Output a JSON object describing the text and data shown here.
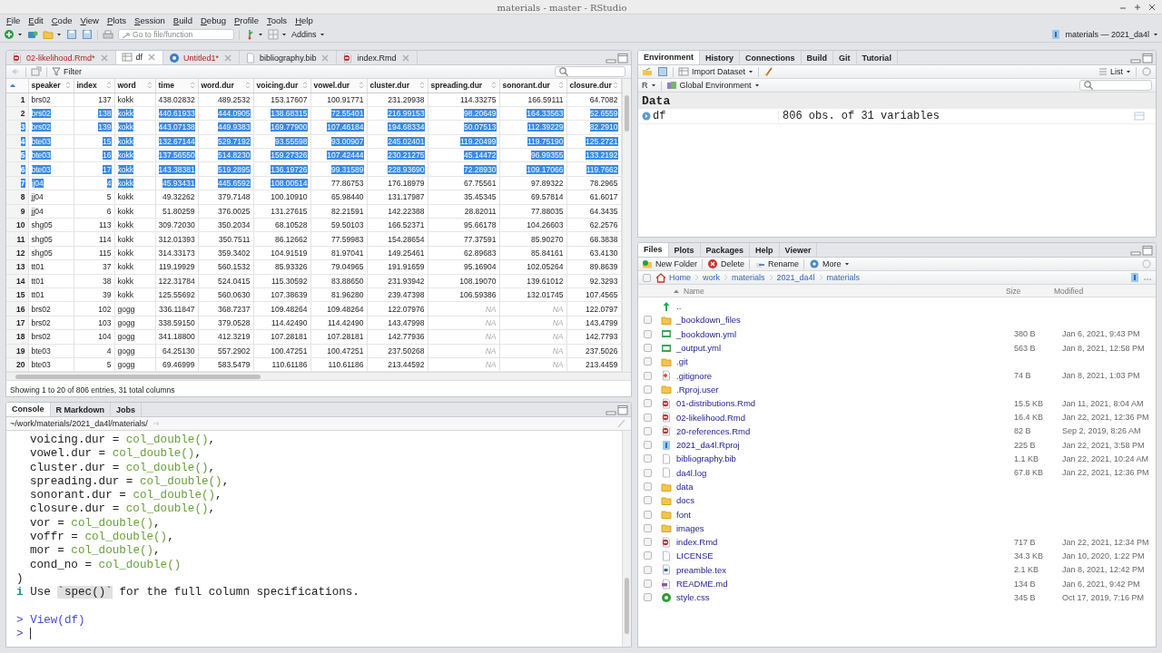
{
  "window": {
    "title": "materials - master - RStudio"
  },
  "menu": [
    "File",
    "Edit",
    "Code",
    "View",
    "Plots",
    "Session",
    "Build",
    "Debug",
    "Profile",
    "Tools",
    "Help"
  ],
  "toolbar": {
    "search_placeholder": "Go to file/function",
    "addins": "Addins",
    "project": "materials — 2021_da4l"
  },
  "source": {
    "tabs": [
      {
        "label": "02-likelihood.Rmd*",
        "kind": "rmd",
        "selected": false,
        "modified": true
      },
      {
        "label": "df",
        "kind": "table",
        "selected": true,
        "modified": false
      },
      {
        "label": "Untitled1*",
        "kind": "script",
        "selected": false,
        "modified": true
      },
      {
        "label": "bibliography.bib",
        "kind": "file",
        "selected": false,
        "modified": false
      },
      {
        "label": "index.Rmd",
        "kind": "rmd",
        "selected": false,
        "modified": false
      }
    ],
    "filter": "Filter",
    "table": {
      "columns": [
        {
          "label": "speaker",
          "kind": "text"
        },
        {
          "label": "index",
          "kind": "number"
        },
        {
          "label": "word",
          "kind": "text"
        },
        {
          "label": "time",
          "kind": "number"
        },
        {
          "label": "word.dur",
          "kind": "number"
        },
        {
          "label": "voicing.dur",
          "kind": "number"
        },
        {
          "label": "vowel.dur",
          "kind": "number"
        },
        {
          "label": "cluster.dur",
          "kind": "number"
        },
        {
          "label": "spreading.dur",
          "kind": "number"
        },
        {
          "label": "sonorant.dur",
          "kind": "number"
        },
        {
          "label": "closure.dur",
          "kind": "number"
        }
      ],
      "rows": [
        {
          "number": "1",
          "cells": [
            "brs02",
            "137",
            "kokk",
            "438.02832",
            "489.2532",
            "153.17607",
            "100.91771",
            "231.29938",
            "114.33275",
            "166.59111",
            "64.7082"
          ]
        },
        {
          "number": "2",
          "cells": [
            "brs02",
            "138",
            "kokk",
            "440.61933",
            "444.0905",
            "138.68315",
            "72.55401",
            "216.99153",
            "98.20649",
            "164.33563",
            "52.6559"
          ],
          "selected": [
            false,
            true,
            true,
            true,
            true,
            true,
            true,
            true,
            true,
            true,
            true,
            true
          ]
        },
        {
          "number": "3",
          "cells": [
            "brs02",
            "139",
            "kokk",
            "443.07138",
            "449.9383",
            "169.77900",
            "107.46184",
            "194.68334",
            "50.07513",
            "112.39229",
            "82.2910"
          ],
          "selected": [
            true,
            true,
            true,
            true,
            true,
            true,
            true,
            true,
            true,
            true,
            true,
            true
          ]
        },
        {
          "number": "4",
          "cells": [
            "bte03",
            "15",
            "kokk",
            "132.67144",
            "529.7192",
            "93.55598",
            "93.00907",
            "245.02401",
            "119.20499",
            "119.75190",
            "125.2721"
          ],
          "selected": [
            true,
            true,
            true,
            true,
            true,
            true,
            true,
            true,
            true,
            true,
            true,
            true
          ]
        },
        {
          "number": "5",
          "cells": [
            "bte03",
            "16",
            "kokk",
            "137.56550",
            "514.8230",
            "159.27326",
            "107.42444",
            "230.21275",
            "45.14472",
            "96.99355",
            "133.2192"
          ],
          "selected": [
            true,
            true,
            true,
            true,
            true,
            true,
            true,
            true,
            true,
            true,
            true,
            true
          ]
        },
        {
          "number": "6",
          "cells": [
            "bte03",
            "17",
            "kokk",
            "143.38381",
            "519.2895",
            "136.19726",
            "99.31589",
            "228.93690",
            "72.28930",
            "109.17066",
            "119.7662"
          ],
          "selected": [
            true,
            true,
            true,
            true,
            true,
            true,
            true,
            true,
            true,
            true,
            true,
            true
          ]
        },
        {
          "number": "7",
          "cells": [
            "jj04",
            "4",
            "kokk",
            "45.93431",
            "445.6592",
            "108.00514",
            "77.86753",
            "176.18979",
            "67.75561",
            "97.89322",
            "78.2965"
          ],
          "selected": [
            true,
            true,
            true,
            true,
            true,
            true,
            true,
            false,
            false,
            false,
            false,
            false
          ]
        },
        {
          "number": "8",
          "cells": [
            "jj04",
            "5",
            "kokk",
            "49.32262",
            "379.7148",
            "100.10910",
            "65.98440",
            "131.17987",
            "35.45345",
            "69.57814",
            "61.6017"
          ]
        },
        {
          "number": "9",
          "cells": [
            "jj04",
            "6",
            "kokk",
            "51.80259",
            "376.0025",
            "131.27615",
            "82.21591",
            "142.22388",
            "28.82011",
            "77.88035",
            "64.3435"
          ]
        },
        {
          "number": "10",
          "cells": [
            "shg05",
            "113",
            "kokk",
            "309.72030",
            "350.2034",
            "68.10528",
            "59.50103",
            "166.52371",
            "95.66178",
            "104.26603",
            "62.2576"
          ]
        },
        {
          "number": "11",
          "cells": [
            "shg05",
            "114",
            "kokk",
            "312.01393",
            "350.7511",
            "86.12662",
            "77.59983",
            "154.28654",
            "77.37591",
            "85.90270",
            "68.3838"
          ]
        },
        {
          "number": "12",
          "cells": [
            "shg05",
            "115",
            "kokk",
            "314.33173",
            "359.3402",
            "104.91519",
            "81.97041",
            "149.25461",
            "62.89683",
            "85.84161",
            "63.4130"
          ]
        },
        {
          "number": "13",
          "cells": [
            "tt01",
            "37",
            "kokk",
            "119.19929",
            "560.1532",
            "85.93326",
            "79.04965",
            "191.91659",
            "95.16904",
            "102.05264",
            "89.8639"
          ]
        },
        {
          "number": "14",
          "cells": [
            "tt01",
            "38",
            "kokk",
            "122.31784",
            "524.0415",
            "115.30592",
            "83.88650",
            "231.93942",
            "108.19070",
            "139.61012",
            "92.3293"
          ]
        },
        {
          "number": "15",
          "cells": [
            "tt01",
            "39",
            "kokk",
            "125.55692",
            "560.0630",
            "107.38639",
            "81.96280",
            "239.47398",
            "106.59386",
            "132.01745",
            "107.4565"
          ]
        },
        {
          "number": "16",
          "cells": [
            "brs02",
            "102",
            "gogg",
            "336.11847",
            "368.7237",
            "109.48264",
            "109.48264",
            "122.07976",
            {
              "text": "NA",
              "kind": "na"
            },
            {
              "text": "NA",
              "kind": "na"
            },
            "122.0797"
          ]
        },
        {
          "number": "17",
          "cells": [
            "brs02",
            "103",
            "gogg",
            "338.59150",
            "379.0528",
            "114.42490",
            "114.42490",
            "143.47998",
            {
              "text": "NA",
              "kind": "na"
            },
            {
              "text": "NA",
              "kind": "na"
            },
            "143.4799"
          ]
        },
        {
          "number": "18",
          "cells": [
            "brs02",
            "104",
            "gogg",
            "341.18800",
            "412.3219",
            "107.28181",
            "107.28181",
            "142.77936",
            {
              "text": "NA",
              "kind": "na"
            },
            {
              "text": "NA",
              "kind": "na"
            },
            "142.7793"
          ]
        },
        {
          "number": "19",
          "cells": [
            "bte03",
            "4",
            "gogg",
            "64.25130",
            "557.2902",
            "100.47251",
            "100.47251",
            "237.50268",
            {
              "text": "NA",
              "kind": "na"
            },
            {
              "text": "NA",
              "kind": "na"
            },
            "237.5026"
          ]
        },
        {
          "number": "20",
          "cells": [
            "bte03",
            "5",
            "gogg",
            "69.46999",
            "583.5479",
            "110.61186",
            "110.61186",
            "213.44592",
            {
              "text": "NA",
              "kind": "na"
            },
            {
              "text": "NA",
              "kind": "na"
            },
            "213.4459"
          ]
        }
      ]
    },
    "footer": "Showing 1 to 20 of 806 entries, 31 total columns"
  },
  "console": {
    "tabs": [
      {
        "label": "Console",
        "selected": true
      },
      {
        "label": "R Markdown",
        "selected": false
      },
      {
        "label": "Jobs",
        "selected": false
      }
    ],
    "path": "~/work/materials/2021_da4l/materials/",
    "lines": [
      {
        "kind": "arg",
        "text": "voicing.dur = ",
        "call": "col_double()",
        "end": ","
      },
      {
        "kind": "arg",
        "text": "vowel.dur = ",
        "call": "col_double()",
        "end": ","
      },
      {
        "kind": "arg",
        "text": "cluster.dur = ",
        "call": "col_double()",
        "end": ","
      },
      {
        "kind": "arg",
        "text": "spreading.dur = ",
        "call": "col_double()",
        "end": ","
      },
      {
        "kind": "arg",
        "text": "sonorant.dur = ",
        "call": "col_double()",
        "end": ","
      },
      {
        "kind": "arg",
        "text": "closure.dur = ",
        "call": "col_double()",
        "end": ","
      },
      {
        "kind": "arg",
        "text": "vor = ",
        "call": "col_double()",
        "end": ","
      },
      {
        "kind": "arg",
        "text": "voffr = ",
        "call": "col_double()",
        "end": ","
      },
      {
        "kind": "arg",
        "text": "mor = ",
        "call": "col_double()",
        "end": ","
      },
      {
        "kind": "arg",
        "text": "cond_no = ",
        "call": "col_double()"
      },
      {
        "kind": "plain",
        "text": ")"
      },
      {
        "kind": "info",
        "mark": "i",
        "text": "Use ",
        "code": "`spec()`",
        "rest": " for the full column specifications."
      },
      {
        "kind": "blank"
      },
      {
        "kind": "input",
        "prompt": ">",
        "text": "View(df)"
      },
      {
        "kind": "input",
        "prompt": ">",
        "cursor": true
      }
    ]
  },
  "environment": {
    "tabs": [
      {
        "label": "Environment",
        "selected": true
      },
      {
        "label": "History",
        "selected": false
      },
      {
        "label": "Connections",
        "selected": false
      },
      {
        "label": "Build",
        "selected": false
      },
      {
        "label": "Git",
        "selected": false
      },
      {
        "label": "Tutorial",
        "selected": false
      }
    ],
    "import": "Import Dataset",
    "view": "List",
    "language": "R",
    "scope": "Global Environment",
    "section": "Data",
    "items": [
      {
        "name": "df",
        "value": "806 obs. of 31 variables"
      }
    ]
  },
  "files": {
    "tabs": [
      {
        "label": "Files",
        "selected": true
      },
      {
        "label": "Plots",
        "selected": false
      },
      {
        "label": "Packages",
        "selected": false
      },
      {
        "label": "Help",
        "selected": false
      },
      {
        "label": "Viewer",
        "selected": false
      }
    ],
    "actions": [
      "New Folder",
      "Delete",
      "Rename",
      "More"
    ],
    "path": [
      "Home",
      "work",
      "materials",
      "2021_da4l",
      "materials"
    ],
    "all_checked": false,
    "columns": [
      "Name",
      "Size",
      "Modified"
    ],
    "items": [
      {
        "name": "..",
        "kind": "up"
      },
      {
        "name": "_bookdown_files",
        "kind": "folder",
        "checked": false
      },
      {
        "name": "_bookdown.yml",
        "kind": "yml",
        "size": "380 B",
        "modified": "Jan 6, 2021, 9:43 PM",
        "checked": false
      },
      {
        "name": "_output.yml",
        "kind": "yml",
        "size": "563 B",
        "modified": "Jan 8, 2021, 12:58 PM",
        "checked": false
      },
      {
        "name": ".git",
        "kind": "folder",
        "checked": false
      },
      {
        "name": ".gitignore",
        "kind": "git",
        "size": "74 B",
        "modified": "Jan 8, 2021, 1:03 PM",
        "checked": false
      },
      {
        "name": ".Rproj.user",
        "kind": "folder",
        "checked": false
      },
      {
        "name": "01-distributions.Rmd",
        "kind": "rmd",
        "size": "15.5 KB",
        "modified": "Jan 11, 2021, 8:04 AM",
        "checked": false
      },
      {
        "name": "02-likelihood.Rmd",
        "kind": "rmd",
        "size": "16.4 KB",
        "modified": "Jan 22, 2021, 12:36 PM",
        "checked": false
      },
      {
        "name": "20-references.Rmd",
        "kind": "rmd",
        "size": "82 B",
        "modified": "Sep 2, 2019, 8:26 AM",
        "checked": false
      },
      {
        "name": "2021_da4l.Rproj",
        "kind": "rproj",
        "size": "225 B",
        "modified": "Jan 22, 2021, 3:58 PM",
        "checked": false
      },
      {
        "name": "bibliography.bib",
        "kind": "file",
        "size": "1.1 KB",
        "modified": "Jan 22, 2021, 10:24 AM",
        "checked": false
      },
      {
        "name": "da4l.log",
        "kind": "file",
        "size": "67.8 KB",
        "modified": "Jan 22, 2021, 12:36 PM",
        "checked": false
      },
      {
        "name": "data",
        "kind": "folder",
        "checked": false
      },
      {
        "name": "docs",
        "kind": "folder",
        "checked": false
      },
      {
        "name": "font",
        "kind": "folder",
        "checked": false
      },
      {
        "name": "images",
        "kind": "folder",
        "checked": false
      },
      {
        "name": "index.Rmd",
        "kind": "rmd",
        "size": "717 B",
        "modified": "Jan 22, 2021, 12:34 PM",
        "checked": false
      },
      {
        "name": "LICENSE",
        "kind": "file",
        "size": "34.3 KB",
        "modified": "Jan 10, 2020, 1:22 PM",
        "checked": false
      },
      {
        "name": "preamble.tex",
        "kind": "tex",
        "size": "2.1 KB",
        "modified": "Jan 8, 2021, 12:42 PM",
        "checked": false
      },
      {
        "name": "README.md",
        "kind": "md",
        "size": "134 B",
        "modified": "Jan 6, 2021, 9:42 PM",
        "checked": false
      },
      {
        "name": "style.css",
        "kind": "css",
        "size": "345 B",
        "modified": "Oct 17, 2019, 7:16 PM",
        "checked": false
      }
    ]
  }
}
